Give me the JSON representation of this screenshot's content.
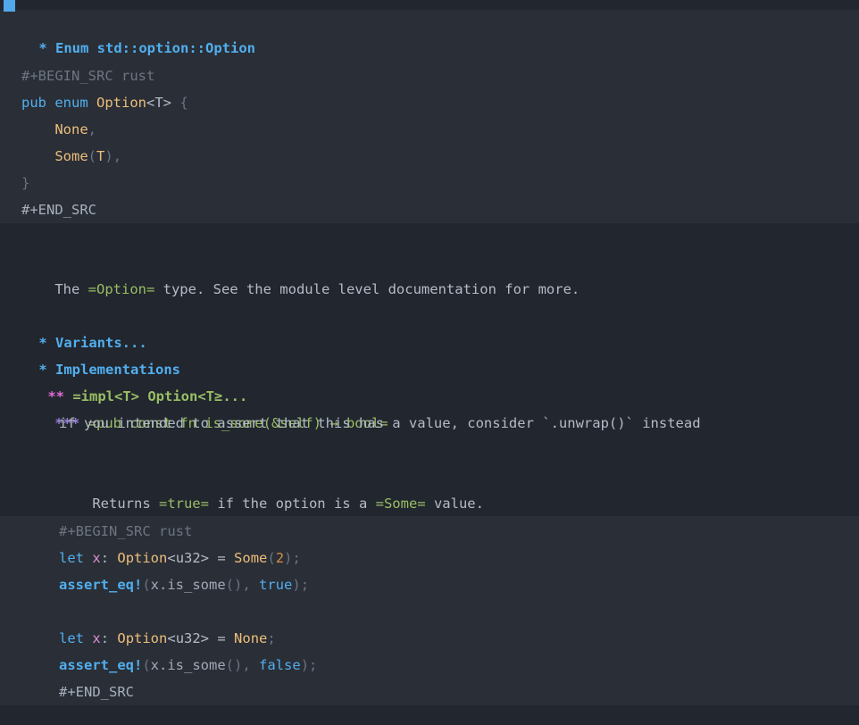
{
  "window": {
    "title": "Enum std::option::Option",
    "theme": "doom-one-dark",
    "mode": "org-mode"
  },
  "colors": {
    "background": "#22262e",
    "band_background": "#2a2e36",
    "heading1": "#51afef",
    "heading2_text": "#98be65",
    "heading2_stars": "#e06bd4",
    "heading3_stars": "#9a7fd6",
    "body_text": "#b4bcc8",
    "verbatim": "#98be65",
    "keyword": "#51afef",
    "type": "#ecbe7b",
    "variable": "#da8fd0",
    "number": "#d98e48",
    "punctuation": "#6a7385",
    "src_marker": "#6d7582",
    "cursor": "#51a8ea"
  },
  "heading_top": {
    "stars": "*",
    "text": "Enum std::option::Option"
  },
  "src_block_1": {
    "begin": "#+BEGIN_SRC rust",
    "end": "#+END_SRC",
    "lines": [
      {
        "tokens": [
          {
            "t": "pub",
            "c": "kw"
          },
          {
            "t": " ",
            "c": "plain"
          },
          {
            "t": "enum",
            "c": "kw"
          },
          {
            "t": " ",
            "c": "plain"
          },
          {
            "t": "Option",
            "c": "type"
          },
          {
            "t": "<T>",
            "c": "plain"
          },
          {
            "t": " ",
            "c": "plain"
          },
          {
            "t": "{",
            "c": "punc"
          }
        ]
      },
      {
        "tokens": [
          {
            "t": "    ",
            "c": "plain"
          },
          {
            "t": "None",
            "c": "type"
          },
          {
            "t": ",",
            "c": "punc"
          }
        ]
      },
      {
        "tokens": [
          {
            "t": "    ",
            "c": "plain"
          },
          {
            "t": "Some",
            "c": "type"
          },
          {
            "t": "(",
            "c": "punc"
          },
          {
            "t": "T",
            "c": "type"
          },
          {
            "t": ")",
            "c": "punc"
          },
          {
            "t": ",",
            "c": "punc"
          }
        ]
      },
      {
        "tokens": [
          {
            "t": "}",
            "c": "punc"
          }
        ]
      }
    ]
  },
  "description": {
    "prefix": "The ",
    "verbatim": "=Option=",
    "suffix": " type. See the module level documentation for more."
  },
  "heading_variants": {
    "stars": "*",
    "text": "Variants..."
  },
  "heading_implementations": {
    "stars": "*",
    "text": "Implementations"
  },
  "heading_impl_t": {
    "stars": "**",
    "text": "=impl<T> Option<T≥..."
  },
  "heading_is_some": {
    "stars": "***",
    "text": "=pub const fn is_some(&self) → bool="
  },
  "note_line": {
    "text": "if you intended to assert that this has a value, consider `.unwrap()` instead"
  },
  "returns_line": {
    "prefix": "Returns ",
    "verbatim_true": "=true=",
    "middle": " if the option is a ",
    "verbatim_some": "=Some=",
    "suffix": " value."
  },
  "src_block_2": {
    "begin": "#+BEGIN_SRC rust",
    "end": "#+END_SRC",
    "lines": [
      {
        "tokens": [
          {
            "t": "let",
            "c": "kw"
          },
          {
            "t": " ",
            "c": "plain"
          },
          {
            "t": "x",
            "c": "var"
          },
          {
            "t": ": ",
            "c": "plain"
          },
          {
            "t": "Option",
            "c": "type"
          },
          {
            "t": "<u32>",
            "c": "plain"
          },
          {
            "t": " = ",
            "c": "plain"
          },
          {
            "t": "Some",
            "c": "type"
          },
          {
            "t": "(",
            "c": "punc"
          },
          {
            "t": "2",
            "c": "num"
          },
          {
            "t": ")",
            "c": "punc"
          },
          {
            "t": ";",
            "c": "punc"
          }
        ]
      },
      {
        "tokens": [
          {
            "t": "assert_eq!",
            "c": "macro"
          },
          {
            "t": "(",
            "c": "punc"
          },
          {
            "t": "x.is_some",
            "c": "member"
          },
          {
            "t": "()",
            "c": "punc"
          },
          {
            "t": ", ",
            "c": "punc"
          },
          {
            "t": "true",
            "c": "bool"
          },
          {
            "t": ")",
            "c": "punc"
          },
          {
            "t": ";",
            "c": "punc"
          }
        ]
      },
      {
        "tokens": []
      },
      {
        "tokens": [
          {
            "t": "let",
            "c": "kw"
          },
          {
            "t": " ",
            "c": "plain"
          },
          {
            "t": "x",
            "c": "var"
          },
          {
            "t": ": ",
            "c": "plain"
          },
          {
            "t": "Option",
            "c": "type"
          },
          {
            "t": "<u32>",
            "c": "plain"
          },
          {
            "t": " = ",
            "c": "plain"
          },
          {
            "t": "None",
            "c": "type"
          },
          {
            "t": ";",
            "c": "punc"
          }
        ]
      },
      {
        "tokens": [
          {
            "t": "assert_eq!",
            "c": "macro"
          },
          {
            "t": "(",
            "c": "punc"
          },
          {
            "t": "x.is_some",
            "c": "member"
          },
          {
            "t": "()",
            "c": "punc"
          },
          {
            "t": ", ",
            "c": "punc"
          },
          {
            "t": "false",
            "c": "bool"
          },
          {
            "t": ")",
            "c": "punc"
          },
          {
            "t": ";",
            "c": "punc"
          }
        ]
      }
    ]
  }
}
